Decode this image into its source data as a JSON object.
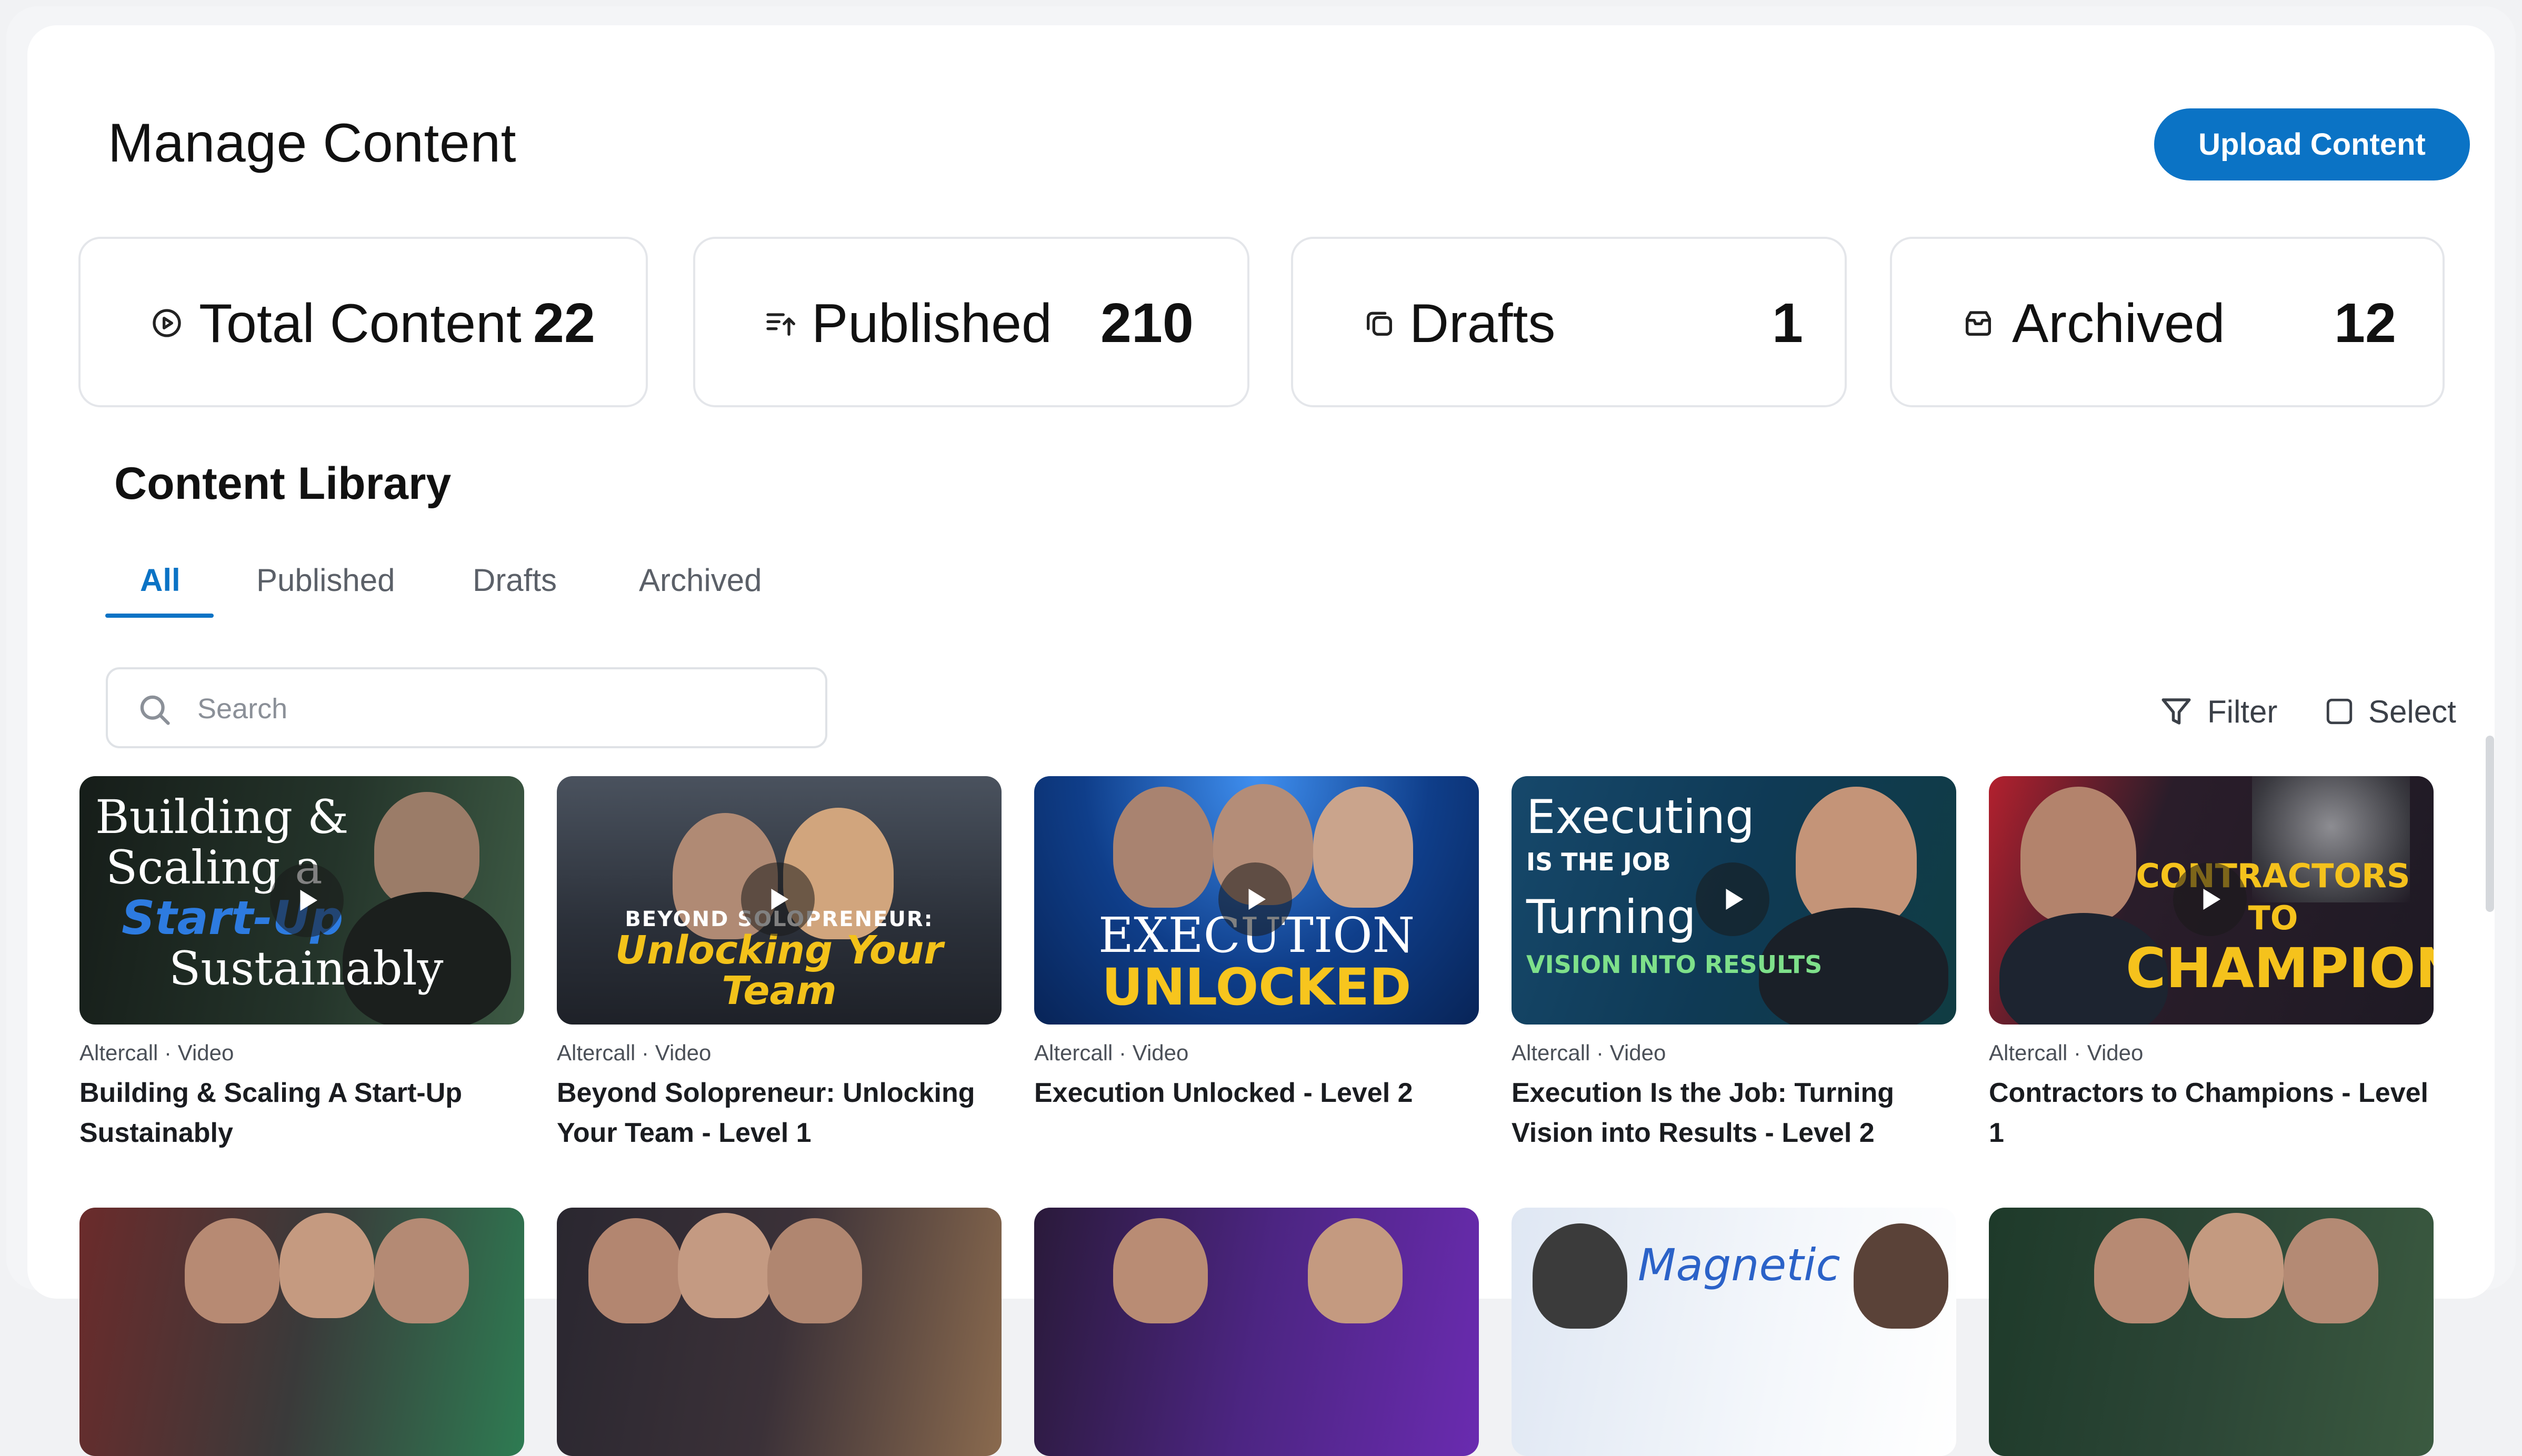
{
  "header": {
    "title": "Manage Content",
    "upload_label": "Upload Content"
  },
  "stats": [
    {
      "label": "Total Content",
      "value": "22",
      "icon": "play-circle-icon"
    },
    {
      "label": "Published",
      "value": "210",
      "icon": "list-upload-icon"
    },
    {
      "label": "Drafts",
      "value": "1",
      "icon": "copy-stack-icon"
    },
    {
      "label": "Archived",
      "value": "12",
      "icon": "archive-box-icon"
    }
  ],
  "library": {
    "title": "Content Library",
    "tabs": [
      {
        "label": "All",
        "active": true
      },
      {
        "label": "Published",
        "active": false
      },
      {
        "label": "Drafts",
        "active": false
      },
      {
        "label": "Archived",
        "active": false
      }
    ],
    "search": {
      "placeholder": "Search",
      "value": ""
    },
    "filter_label": "Filter",
    "select_label": "Select"
  },
  "cards": [
    {
      "meta": "Altercall · Video",
      "title": "Building & Scaling A Start-Up Sustainably",
      "thumb_text": [
        "Building &",
        "Scaling a",
        "Start-Up",
        "Sustainably"
      ],
      "colors": [
        "#1d2a22",
        "#5a7a56"
      ]
    },
    {
      "meta": "Altercall · Video",
      "title": "Beyond Solopreneur: Unlocking Your Team - Level 1",
      "thumb_text": [
        "BEYOND SOLOPRENEUR:",
        "Unlocking Your",
        "Team"
      ],
      "colors": [
        "#2a3140",
        "#6c7687"
      ]
    },
    {
      "meta": "Altercall · Video",
      "title": "Execution Unlocked - Level 2",
      "thumb_text": [
        "EXECUTION",
        "UNLOCKED"
      ],
      "colors": [
        "#0c2f6e",
        "#2d7be0"
      ]
    },
    {
      "meta": "Altercall · Video",
      "title": "Execution Is the Job: Turning Vision into Results - Level 2",
      "thumb_text": [
        "Executing",
        "IS THE JOB",
        "Turning",
        "VISION INTO RESULTS"
      ],
      "colors": [
        "#0e3a57",
        "#178c8f"
      ]
    },
    {
      "meta": "Altercall · Video",
      "title": "Contractors to Champions - Level 1",
      "thumb_text": [
        "CONTRACTORS TO",
        "CHAMPIONS"
      ],
      "colors": [
        "#231c2e",
        "#b32030"
      ]
    }
  ],
  "second_row": [
    {
      "colors": [
        "#6b2b2b",
        "#2e7b52"
      ]
    },
    {
      "colors": [
        "#2a2730",
        "#8a6a4e"
      ]
    },
    {
      "colors": [
        "#2a1a3a",
        "#6a2bb0"
      ]
    },
    {
      "colors": [
        "#dfe7f3",
        "#ffffff"
      ],
      "thumb_text": "Magnetic"
    },
    {
      "colors": [
        "#1e3a2a",
        "#3b5a40"
      ]
    }
  ]
}
